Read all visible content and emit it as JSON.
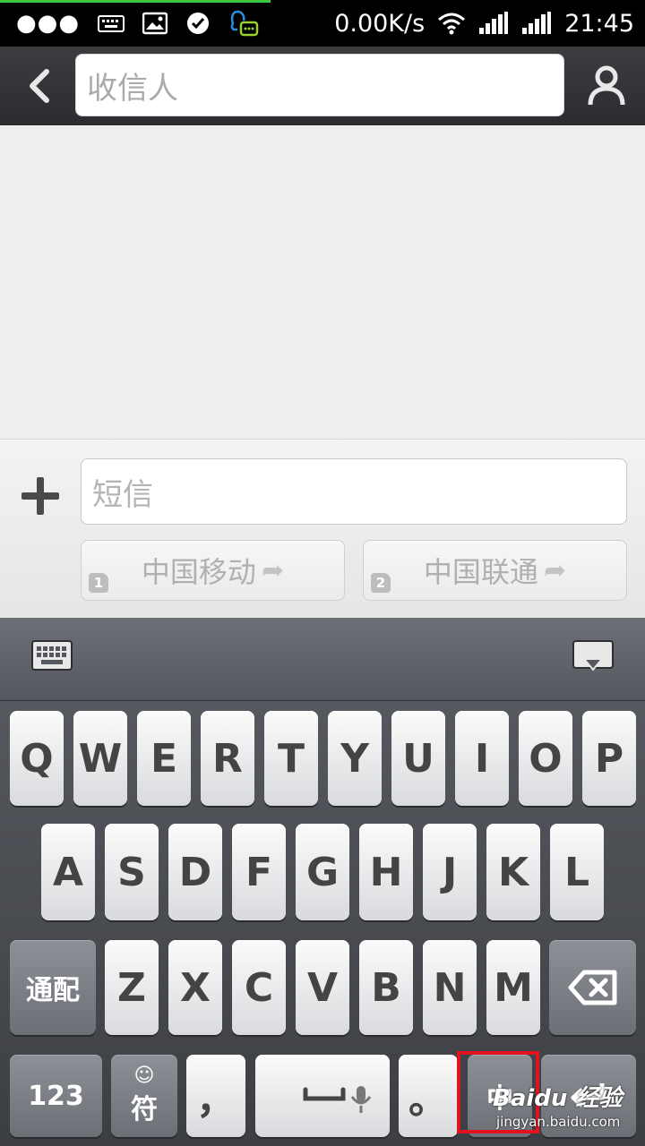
{
  "status_bar": {
    "network_speed": "0.00K/s",
    "time": "21:45",
    "icons": [
      "more-dots-icon",
      "keyboard-icon",
      "image-icon",
      "check-circle-icon",
      "qq-chat-icon",
      "wifi-icon",
      "signal-icon",
      "signal-icon-2"
    ]
  },
  "header": {
    "recipient_placeholder": "收信人"
  },
  "composer": {
    "sms_placeholder": "短信",
    "sim1_label": "中国移动",
    "sim1_badge": "1",
    "sim2_label": "中国联通",
    "sim2_badge": "2"
  },
  "keyboard": {
    "row1": [
      "Q",
      "W",
      "E",
      "R",
      "T",
      "Y",
      "U",
      "I",
      "O",
      "P"
    ],
    "row2": [
      "A",
      "S",
      "D",
      "F",
      "G",
      "H",
      "J",
      "K",
      "L"
    ],
    "row3": [
      "Z",
      "X",
      "C",
      "V",
      "B",
      "N",
      "M"
    ],
    "shift_label": "通配",
    "num_label": "123",
    "symbol_label": "符",
    "comma_label": "，",
    "period_label": "。",
    "lang_label": "中"
  },
  "watermark": {
    "logo": "Baidu 经验",
    "url": "jingyan.baidu.com"
  },
  "colors": {
    "highlight": "#e0141e",
    "status_progress": "#3cc83c"
  }
}
